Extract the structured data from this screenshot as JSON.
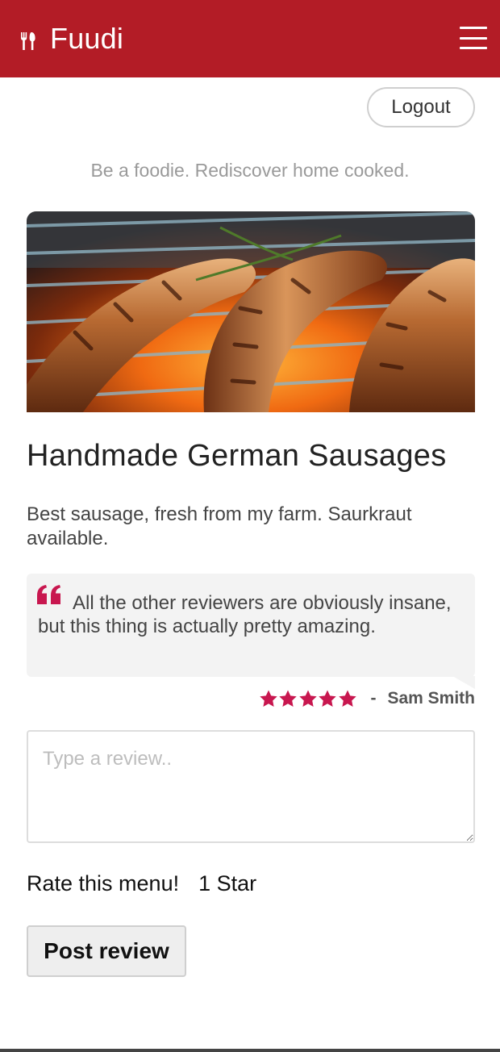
{
  "header": {
    "brand_name": "Fuudi",
    "brand_icon": "utensils-icon",
    "menu_icon": "hamburger-menu-icon",
    "brand_color": "#b31c26"
  },
  "account": {
    "logout_label": "Logout"
  },
  "tagline": "Be a foodie. Rediscover home cooked.",
  "menu_item": {
    "image_alt": "grilled sausages",
    "title": "Handmade German Sausages",
    "description": "Best sausage, fresh from my farm. Saurkraut available."
  },
  "latest_review": {
    "text": "All the other reviewers are obviously insane, but this thing is actually pretty amazing.",
    "rating": 5,
    "rating_max": 5,
    "separator": "-",
    "reviewer": "Sam Smith",
    "star_color": "#c8174f"
  },
  "review_form": {
    "placeholder": "Type a review..",
    "rate_label": "Rate this menu!",
    "rate_value": "1 Star",
    "submit_label": "Post review"
  }
}
